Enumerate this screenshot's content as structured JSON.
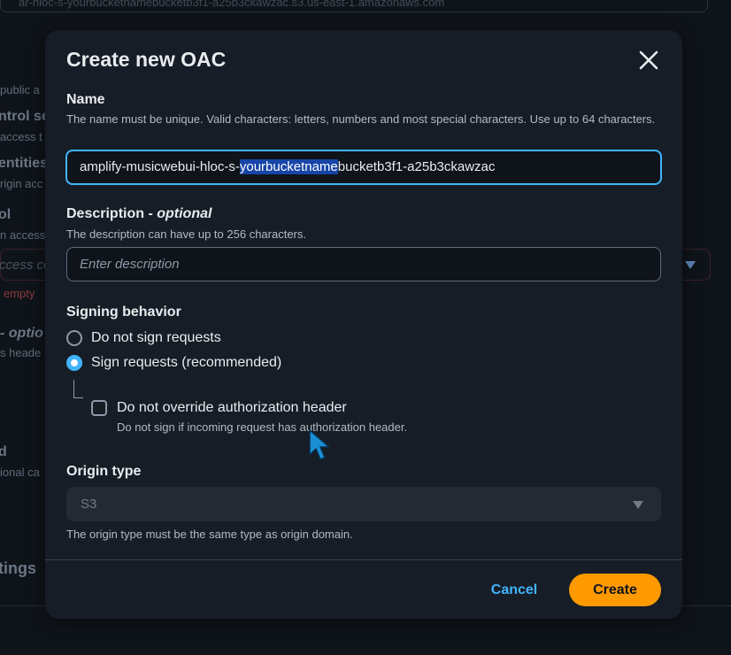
{
  "background": {
    "top_field_text": "ar-hloc-s-yourbucketnamebucketb3f1-a25b3ckawzac.s3.us-east-1.amazonaws.com",
    "fragments": {
      "f1": "public a",
      "f2": "ntrol se",
      "f3": "access t",
      "f4": "entities",
      "f5": "rigin acc",
      "f6": "ol",
      "f7": "n access",
      "f8": "ccess con",
      "f9": "empty",
      "f10": "- optio",
      "f11": "s heade",
      "f12": "d",
      "f13": "ional ca",
      "f14": "tings"
    }
  },
  "modal": {
    "title": "Create new OAC",
    "close_icon": "close-icon",
    "name": {
      "label": "Name",
      "hint": "The name must be unique. Valid characters: letters, numbers and most special characters. Use up to 64 characters.",
      "value_prefix": "amplify-musicwebui-hloc-s-",
      "value_selected": "yourbucketname",
      "value_suffix": "bucketb3f1-a25b3ckawzac"
    },
    "description": {
      "label": "Description",
      "label_optional": "optional",
      "separator": " - ",
      "hint": "The description can have up to 256 characters.",
      "placeholder": "Enter description"
    },
    "signing": {
      "label": "Signing behavior",
      "options": [
        {
          "label": "Do not sign requests",
          "selected": false
        },
        {
          "label": "Sign requests (recommended)",
          "selected": true
        }
      ],
      "override": {
        "label": "Do not override authorization header",
        "hint": "Do not sign if incoming request has authorization header.",
        "checked": false
      }
    },
    "origin_type": {
      "label": "Origin type",
      "value": "S3",
      "hint": "The origin type must be the same type as origin domain."
    },
    "footer": {
      "cancel_label": "Cancel",
      "create_label": "Create"
    }
  },
  "colors": {
    "accent": "#42b4ff",
    "primary_button": "#ff9900",
    "modal_bg": "#161d26",
    "page_bg": "#0f141a"
  }
}
